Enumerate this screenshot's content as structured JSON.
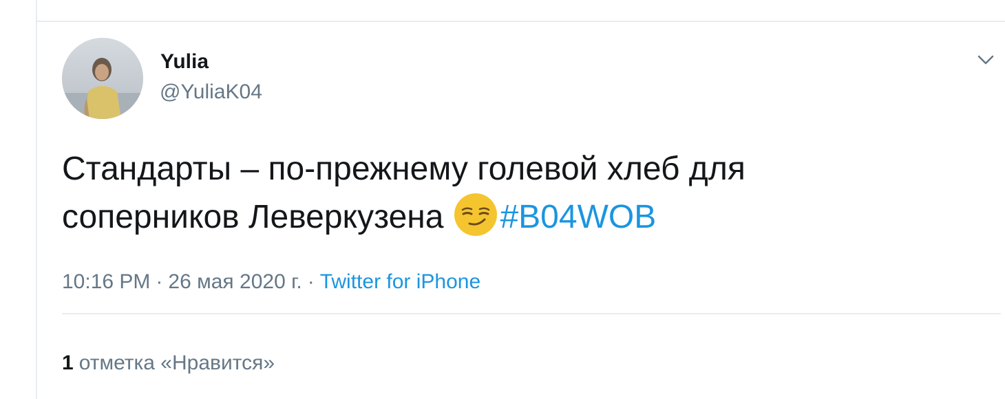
{
  "tweet": {
    "author": {
      "display_name": "Yulia",
      "handle": "@YuliaK04",
      "avatar_icon": "user-avatar-photo"
    },
    "menu_icon": "chevron-down-icon",
    "text_line1": "Стандарты – по-прежнему голевой хлеб для",
    "text_line2": "соперников Леверкузена",
    "emoji_icon": "smirking-face-emoji",
    "hashtag": "#B04WOB",
    "time": "10:16 PM",
    "date": "26 мая 2020 г.",
    "separator": "·",
    "source": "Twitter for iPhone",
    "likes": {
      "count": "1",
      "label": "отметка «Нравится»"
    }
  },
  "colors": {
    "text": "#14171a",
    "secondary": "#657786",
    "link": "#1b95e0",
    "divider": "#e6ecf0",
    "emoji": "#f5c530"
  }
}
